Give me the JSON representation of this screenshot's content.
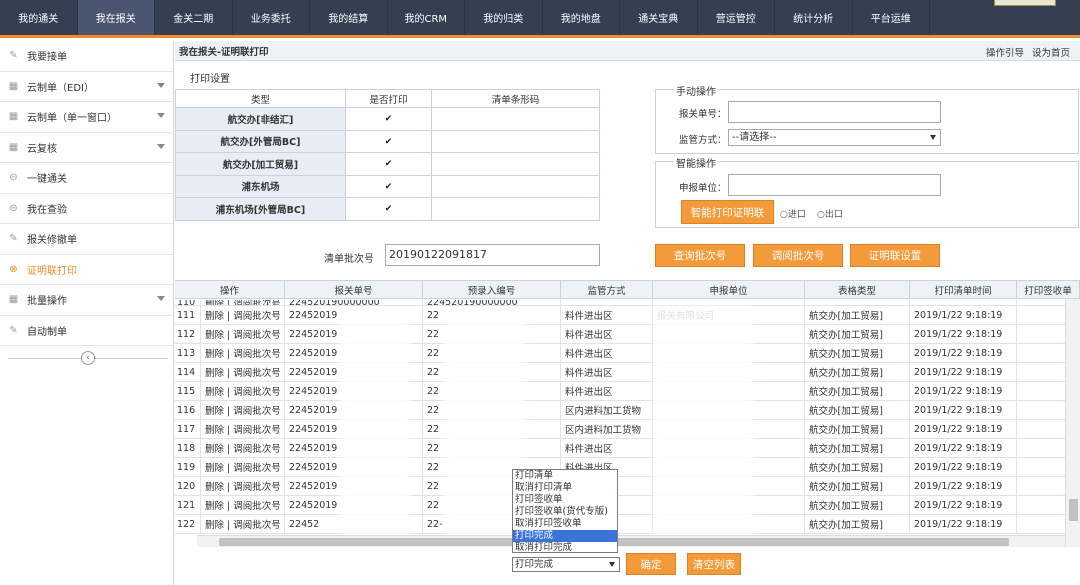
{
  "topnav": {
    "items": [
      "我的通关",
      "我在报关",
      "金关二期",
      "业务委托",
      "我的结算",
      "我的CRM",
      "我的归类",
      "我的地盘",
      "通关宝典",
      "营运管控",
      "统计分析",
      "平台运维"
    ],
    "active_index": 1
  },
  "sidebar": {
    "items": [
      {
        "label": "我要接单",
        "icon": "pencil-icon",
        "has_caret": false
      },
      {
        "label": "云制单（EDI）",
        "icon": "grid-icon",
        "has_caret": true
      },
      {
        "label": "云制单（单一窗口）",
        "icon": "grid-icon",
        "has_caret": true
      },
      {
        "label": "云复核",
        "icon": "grid-icon",
        "has_caret": true
      },
      {
        "label": "一键通关",
        "icon": "minus-circle-icon",
        "has_caret": false
      },
      {
        "label": "我在查验",
        "icon": "minus-circle-icon",
        "has_caret": false
      },
      {
        "label": "报关修撤单",
        "icon": "pencil-icon",
        "has_caret": false
      },
      {
        "label": "证明联打印",
        "icon": "close-circle-icon",
        "has_caret": false
      },
      {
        "label": "批量操作",
        "icon": "grid-icon",
        "has_caret": true
      },
      {
        "label": "自动制单",
        "icon": "pencil-icon",
        "has_caret": false
      }
    ],
    "active_index": 7
  },
  "crumb": {
    "title": "我在报关-证明联打印",
    "guide": "操作引导",
    "set_home": "设为首页"
  },
  "print_settings": {
    "title": "打印设置",
    "headers": [
      "类型",
      "是否打印",
      "清单条形码"
    ],
    "rows": [
      {
        "type": "航交办[非结汇]",
        "checked": true
      },
      {
        "type": "航交办[外管局BC]",
        "checked": true
      },
      {
        "type": "航交办[加工贸易]",
        "checked": true
      },
      {
        "type": "浦东机场",
        "checked": true
      },
      {
        "type": "浦东机场[外管局BC]",
        "checked": true
      }
    ],
    "batch_label": "清单批次号",
    "batch_value": "20190122091817"
  },
  "manual": {
    "legend": "手动操作",
    "decl_label": "报关单号：",
    "decl_value": "",
    "supervision_label": "监管方式：",
    "supervision_value": "--请选择--"
  },
  "smart": {
    "legend": "智能操作",
    "unit_label": "申报单位：",
    "unit_value": "",
    "print_button": "智能打印证明联",
    "radio_import": "进口",
    "radio_export": "出口"
  },
  "buttons": {
    "query_batch": "查询批次号",
    "transfer_batch": "调阅批次号",
    "cert_settings": "证明联设置",
    "confirm": "确定",
    "clear_list": "清空列表"
  },
  "table": {
    "headers": [
      "操作",
      "报关单号",
      "预录入编号",
      "监管方式",
      "申报单位",
      "表格类型",
      "打印清单时间",
      "打印签收单"
    ],
    "action_text": "删除 | 调阅批次号",
    "rows": [
      {
        "no": "110",
        "decl": "224520190000000",
        "pre": "224520190000000",
        "mode": "",
        "unit": "",
        "form": "",
        "time": ""
      },
      {
        "no": "111",
        "decl": "22452019",
        "pre": "22",
        "mode": "料件进出区",
        "unit": "报关有限公司",
        "form": "航交办[加工贸易]",
        "time": "2019/1/22 9:18:19"
      },
      {
        "no": "112",
        "decl": "22452019",
        "pre": "22",
        "mode": "料件进出区",
        "unit": "",
        "form": "航交办[加工贸易]",
        "time": "2019/1/22 9:18:19"
      },
      {
        "no": "113",
        "decl": "22452019",
        "pre": "22",
        "mode": "料件进出区",
        "unit": "",
        "form": "航交办[加工贸易]",
        "time": "2019/1/22 9:18:19"
      },
      {
        "no": "114",
        "decl": "22452019",
        "pre": "22",
        "mode": "料件进出区",
        "unit": "",
        "form": "航交办[加工贸易]",
        "time": "2019/1/22 9:18:19"
      },
      {
        "no": "115",
        "decl": "22452019",
        "pre": "22",
        "mode": "料件进出区",
        "unit": "",
        "form": "航交办[加工贸易]",
        "time": "2019/1/22 9:18:19"
      },
      {
        "no": "116",
        "decl": "22452019",
        "pre": "22",
        "mode": "区内进料加工货物",
        "unit": "",
        "form": "航交办[加工贸易]",
        "time": "2019/1/22 9:18:19"
      },
      {
        "no": "117",
        "decl": "22452019",
        "pre": "22",
        "mode": "区内进料加工货物",
        "unit": "",
        "form": "航交办[加工贸易]",
        "time": "2019/1/22 9:18:19"
      },
      {
        "no": "118",
        "decl": "22452019",
        "pre": "22",
        "mode": "料件进出区",
        "unit": "",
        "form": "航交办[加工贸易]",
        "time": "2019/1/22 9:18:19"
      },
      {
        "no": "119",
        "decl": "22452019",
        "pre": "22",
        "mode": "料件进出区",
        "unit": "",
        "form": "航交办[加工贸易]",
        "time": "2019/1/22 9:18:19"
      },
      {
        "no": "120",
        "decl": "22452019",
        "pre": "22",
        "mode": "",
        "unit": "",
        "form": "航交办[加工贸易]",
        "time": "2019/1/22 9:18:19"
      },
      {
        "no": "121",
        "decl": "22452019",
        "pre": "22",
        "mode": "",
        "unit": "",
        "form": "航交办[加工贸易]",
        "time": "2019/1/22 9:18:19"
      },
      {
        "no": "122",
        "decl": "22452",
        "pre": "22-",
        "mode": "",
        "unit": "",
        "form": "航交办[加工贸易]",
        "time": "2019/1/22 9:18:19"
      }
    ]
  },
  "dropdown": {
    "options": [
      "打印清单",
      "取消打印清单",
      "打印签收单",
      "打印签收单(货代专版)",
      "取消打印签收单",
      "打印完成",
      "取消打印完成"
    ],
    "selected_index": 5,
    "current": "打印完成"
  },
  "colors": {
    "nav_bg": "#343f54",
    "accent": "#f08b2b",
    "button": "#f39a3b"
  }
}
